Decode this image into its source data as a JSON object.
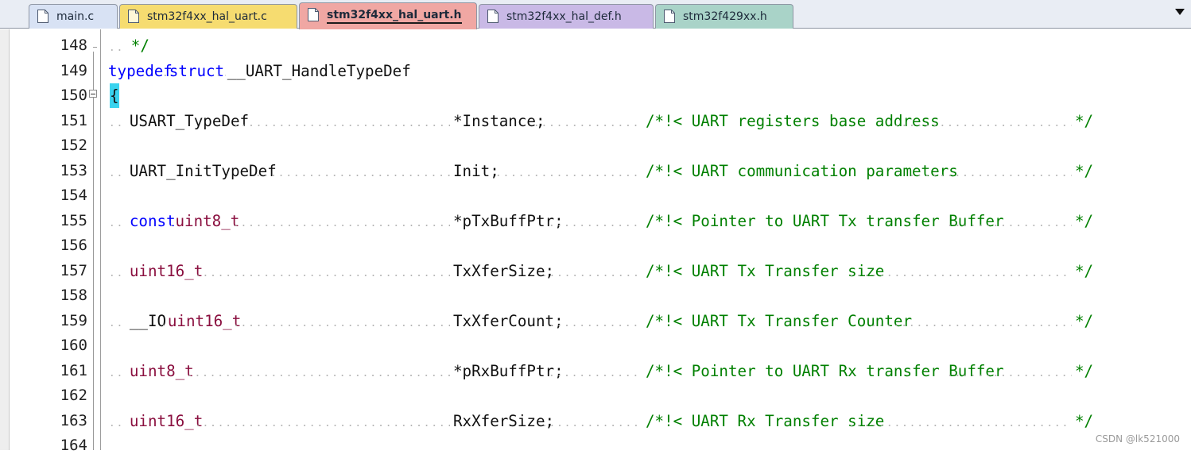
{
  "tabs": [
    {
      "label": "main.c",
      "color": "#d8e2f4",
      "active": false
    },
    {
      "label": "stm32f4xx_hal_uart.c",
      "color": "#f6dc70",
      "active": false
    },
    {
      "label": "stm32f4xx_hal_uart.h",
      "color": "#f0a7a3",
      "active": true
    },
    {
      "label": "stm32f4xx_hal_def.h",
      "color": "#c9b9e6",
      "active": false
    },
    {
      "label": "stm32f429xx.h",
      "color": "#a9d3c8",
      "active": false
    }
  ],
  "tab_menu_icon": "chevron-down-icon",
  "editor": {
    "lines": [
      {
        "num": "148",
        "code": "*/"
      },
      {
        "num": "149",
        "kw1": "typedef",
        "kw2": "struct",
        "name": "__UART_HandleTypeDef"
      },
      {
        "num": "150",
        "brace": "{"
      },
      {
        "num": "151",
        "type": "USART_TypeDef",
        "member": "*Instance;",
        "comment": "/*!< UART registers base address",
        "end": "*/"
      },
      {
        "num": "152"
      },
      {
        "num": "153",
        "type": "UART_InitTypeDef",
        "member": "Init;",
        "comment": "/*!< UART communication parameters",
        "end": "*/"
      },
      {
        "num": "154"
      },
      {
        "num": "155",
        "qual": "const",
        "type": "uint8_t",
        "member": "*pTxBuffPtr;",
        "comment": "/*!< Pointer to UART Tx transfer Buffer",
        "end": "*/"
      },
      {
        "num": "156"
      },
      {
        "num": "157",
        "type": "uint16_t",
        "member": "TxXferSize;",
        "comment": "/*!< UART Tx Transfer size",
        "end": "*/"
      },
      {
        "num": "158"
      },
      {
        "num": "159",
        "qual": "__IO",
        "type": "uint16_t",
        "member": "TxXferCount;",
        "comment": "/*!< UART Tx Transfer Counter",
        "end": "*/"
      },
      {
        "num": "160"
      },
      {
        "num": "161",
        "type": "uint8_t",
        "member": "*pRxBuffPtr;",
        "comment": "/*!< Pointer to UART Rx transfer Buffer",
        "end": "*/"
      },
      {
        "num": "162"
      },
      {
        "num": "163",
        "type": "uint16_t",
        "member": "RxXferSize;",
        "comment": "/*!< UART Rx Transfer size",
        "end": "*/"
      },
      {
        "num": "164"
      }
    ]
  },
  "colors": {
    "keyword": "#0000ff",
    "type": "#8a0f3f",
    "comment": "#008000",
    "brace_highlight": "#3ad3ee"
  },
  "watermark": "CSDN @lk521000"
}
